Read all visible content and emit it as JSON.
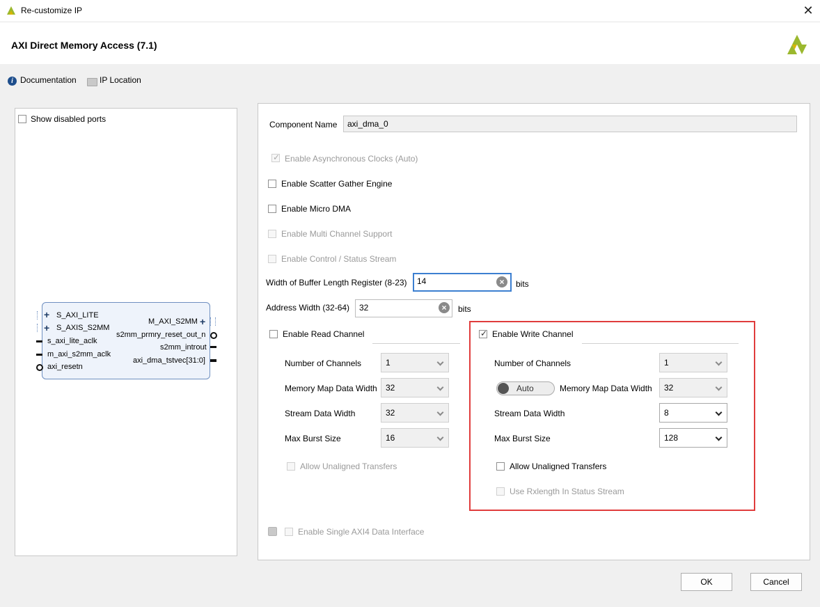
{
  "window": {
    "title": "Re-customize IP",
    "close_glyph": "✕",
    "logo": "xilinx-logo-icon"
  },
  "header": {
    "title": "AXI Direct Memory Access (7.1)",
    "documentation_label": "Documentation",
    "ip_location_label": "IP Location"
  },
  "left_panel": {
    "show_disabled_ports": "Show disabled ports",
    "ports_left": [
      "S_AXI_LITE",
      "S_AXIS_S2MM",
      "s_axi_lite_aclk",
      "m_axi_s2mm_aclk",
      "axi_resetn"
    ],
    "ports_right": [
      "M_AXI_S2MM",
      "s2mm_prmry_reset_out_n",
      "s2mm_introut",
      "axi_dma_tstvec[31:0]"
    ]
  },
  "component": {
    "name_label": "Component Name",
    "name_value": "axi_dma_0"
  },
  "options": {
    "async_clocks": "Enable Asynchronous Clocks (Auto)",
    "scatter_gather": "Enable Scatter Gather Engine",
    "micro_dma": "Enable Micro DMA",
    "multi_channel": "Enable Multi Channel Support",
    "control_status": "Enable Control / Status Stream",
    "single_axi4": "Enable Single AXI4 Data Interface"
  },
  "buffer_length": {
    "label": "Width of Buffer Length Register (8-23)",
    "value": "14",
    "unit": "bits"
  },
  "address_width": {
    "label": "Address Width (32-64)",
    "value": "32",
    "unit": "bits"
  },
  "read_channel": {
    "enable_label": "Enable Read Channel",
    "num_channels_label": "Number of Channels",
    "num_channels_value": "1",
    "mm_width_label": "Memory Map Data Width",
    "mm_width_value": "32",
    "stream_width_label": "Stream Data Width",
    "stream_width_value": "32",
    "max_burst_label": "Max Burst Size",
    "max_burst_value": "16",
    "unaligned_label": "Allow Unaligned Transfers"
  },
  "write_channel": {
    "enable_label": "Enable Write Channel",
    "num_channels_label": "Number of Channels",
    "num_channels_value": "1",
    "auto_label": "Auto",
    "mm_width_label": "Memory Map Data Width",
    "mm_width_value": "32",
    "stream_width_label": "Stream Data Width",
    "stream_width_value": "8",
    "max_burst_label": "Max Burst Size",
    "max_burst_value": "128",
    "unaligned_label": "Allow Unaligned Transfers",
    "rxlength_label": "Use Rxlength In Status Stream"
  },
  "footer": {
    "ok_label": "OK",
    "cancel_label": "Cancel"
  },
  "colors": {
    "highlight_box": "#e03c3c",
    "focus_border": "#3c7fd1",
    "logo_green": "#9bb82e"
  }
}
